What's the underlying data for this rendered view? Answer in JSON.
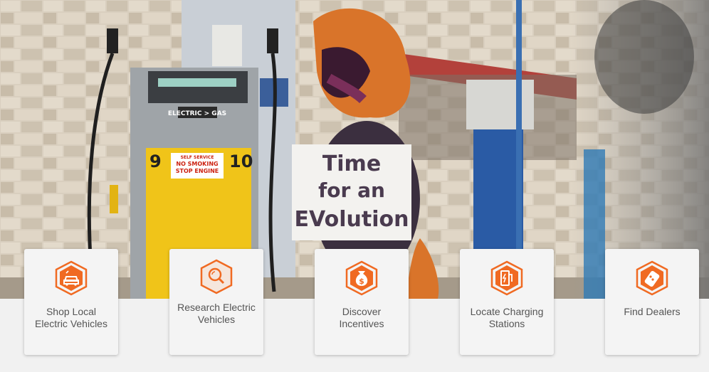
{
  "hero": {
    "sign_lines": [
      "Time",
      "for an",
      "EVolution"
    ],
    "pump_left_number": "9",
    "pump_right_number": "10",
    "pump_header": "ELECTRIC > GAS",
    "pump_sticker": [
      "SELF SERVICE",
      "NO SMOKING",
      "STOP ENGINE"
    ]
  },
  "cards": [
    {
      "label": "Shop Local Electric Vehicles",
      "icon": "car-charging-icon"
    },
    {
      "label": "Research Electric Vehicles",
      "icon": "magnifier-icon"
    },
    {
      "label": "Discover Incentives",
      "icon": "money-bag-icon"
    },
    {
      "label": "Locate Charging Stations",
      "icon": "charging-station-icon"
    },
    {
      "label": "Find Dealers",
      "icon": "key-fob-icon"
    }
  ],
  "colors": {
    "accent": "#f06a22"
  }
}
